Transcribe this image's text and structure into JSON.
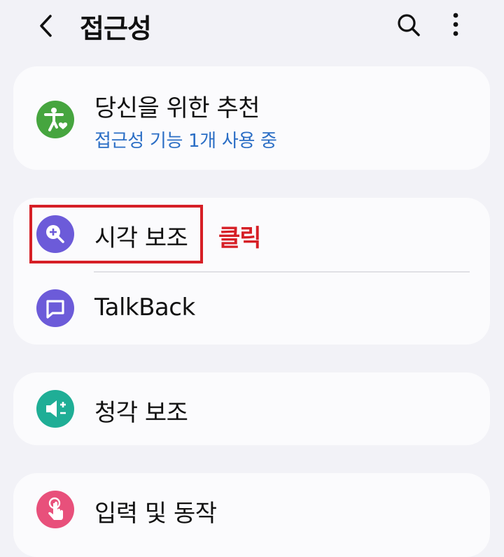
{
  "header": {
    "title": "접근성",
    "back_icon": "chevron-left-icon",
    "search_icon": "search-icon",
    "more_icon": "more-vertical-icon"
  },
  "recommend": {
    "label": "당신을 위한 추천",
    "sub": "접근성 기능 1개 사용 중",
    "icon": "accessibility-person-icon",
    "icon_color": "#46a53f"
  },
  "group1": [
    {
      "label": "시각 보조",
      "icon": "magnify-plus-icon",
      "icon_color": "#6c5bd9"
    },
    {
      "label": "TalkBack",
      "icon": "speech-bubble-icon",
      "icon_color": "#6c5bd9"
    }
  ],
  "group2": [
    {
      "label": "청각 보조",
      "icon": "speaker-plus-minus-icon",
      "icon_color": "#1fae96"
    }
  ],
  "group3": [
    {
      "label": "입력 및 동작",
      "icon": "hand-touch-icon",
      "icon_color": "#e8507b"
    }
  ],
  "annotation": {
    "text": "클릭",
    "color": "#d61f26"
  }
}
